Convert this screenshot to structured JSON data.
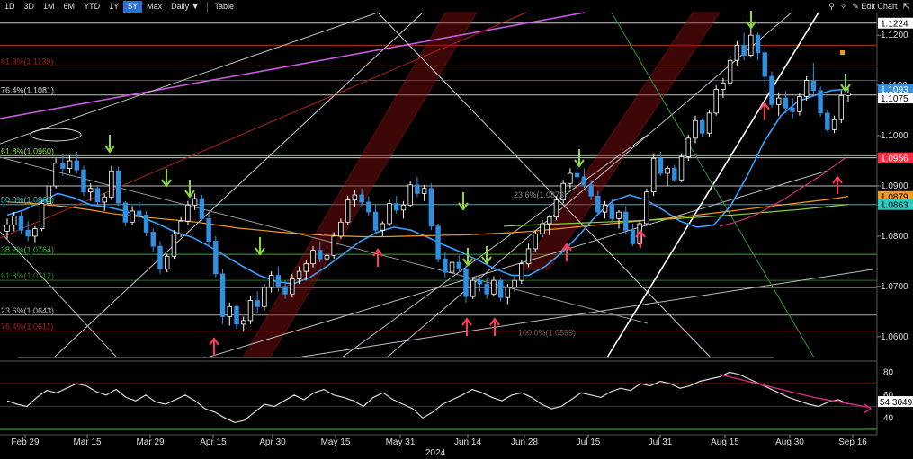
{
  "toolbar": {
    "ranges": [
      "1D",
      "3D",
      "1M",
      "6M",
      "YTD",
      "1Y",
      "5Y",
      "Max"
    ],
    "active_range": "5Y",
    "frequency": "Daily ▼",
    "table": "Table",
    "edit": "Edit Chart"
  },
  "chart_data": [
    {
      "type": "candlestick",
      "title": "",
      "ylim": [
        1.0555,
        1.1245
      ],
      "y_ticks": [
        "1.1200",
        "1.1100",
        "1.1000",
        "1.0900",
        "1.0800",
        "1.0700",
        "1.0600"
      ],
      "y_tick_values": [
        1.12,
        1.11,
        1.1,
        1.09,
        1.08,
        1.07,
        1.06
      ],
      "x_ticks": [
        "Feb 29",
        "Mar 15",
        "Mar 29",
        "Apr 15",
        "Apr 30",
        "May 15",
        "May 31",
        "Jun 14",
        "Jun 28",
        "Jul 15",
        "Jul 31",
        "Aug 15",
        "Aug 30",
        "Sep 16"
      ],
      "x_tick_dates": [
        "2024-02-29",
        "2024-03-15",
        "2024-03-29",
        "2024-04-15",
        "2024-04-30",
        "2024-05-15",
        "2024-05-31",
        "2024-06-14",
        "2024-06-28",
        "2024-07-15",
        "2024-07-31",
        "2024-08-15",
        "2024-08-30",
        "2024-09-16"
      ],
      "year_label": "2024",
      "price_tags": [
        {
          "text": "1.1224",
          "value": 1.1224,
          "bg": "#ffffff",
          "fg": "#000000"
        },
        {
          "text": "1.1093",
          "value": 1.1093,
          "bg": "#2f8fe0",
          "fg": "#ffffff"
        },
        {
          "text": "1.1075",
          "value": 1.1075,
          "bg": "#ffffff",
          "fg": "#000000"
        },
        {
          "text": "1.0956",
          "value": 1.0956,
          "bg": "#ff2b40",
          "fg": "#ffffff"
        },
        {
          "text": "1.0879",
          "value": 1.0879,
          "bg": "#f39a1e",
          "fg": "#000000"
        },
        {
          "text": "1.0863",
          "value": 1.0863,
          "bg": "#2fc9c0",
          "fg": "#000000"
        }
      ],
      "fib_labels": [
        {
          "text": "76.4%(1.1081)",
          "value": 1.1081,
          "color": "#d9d9d9"
        },
        {
          "text": "61.8%(1.0960)",
          "value": 1.096,
          "color": "#9fd84a"
        },
        {
          "text": "50.0%(1.0863)",
          "value": 1.0863,
          "color": "#2fc9c0"
        },
        {
          "text": "38.2%(1.0764)",
          "value": 1.0764,
          "color": "#39c23f"
        },
        {
          "text": "23.6%(1.0643)",
          "value": 1.0643,
          "color": "#bdbdbd"
        },
        {
          "text": "76.4%(1.0611)",
          "value": 1.0611,
          "color": "#b02020"
        },
        {
          "text": "61.8%(1.1139)",
          "value": 1.1139,
          "color": "#a02020"
        },
        {
          "text": "61.8%(1.0712)",
          "value": 1.0712,
          "color": "#2f7f2f"
        },
        {
          "text": "23.6%(1.0873)",
          "value": 1.0873,
          "color": "#8a8a8a"
        },
        {
          "text": "100.0%(1.0599)",
          "value": 1.0599,
          "color": "#6a6a6a"
        }
      ],
      "ohlc": [
        [
          1.081,
          1.0835,
          1.0795,
          1.0822
        ],
        [
          1.0822,
          1.0848,
          1.081,
          1.084
        ],
        [
          1.084,
          1.0848,
          1.0805,
          1.0812
        ],
        [
          1.0812,
          1.083,
          1.079,
          1.08
        ],
        [
          1.08,
          1.082,
          1.0788,
          1.0815
        ],
        [
          1.0815,
          1.0872,
          1.081,
          1.0865
        ],
        [
          1.0865,
          1.091,
          1.0858,
          1.09
        ],
        [
          1.09,
          1.0955,
          1.0895,
          1.0945
        ],
        [
          1.0945,
          1.0962,
          1.092,
          1.0935
        ],
        [
          1.0935,
          1.096,
          1.0925,
          1.095
        ],
        [
          1.095,
          1.0968,
          1.0925,
          1.0932
        ],
        [
          1.0932,
          1.094,
          1.088,
          1.0888
        ],
        [
          1.0888,
          1.0905,
          1.087,
          1.0895
        ],
        [
          1.0895,
          1.09,
          1.086,
          1.0868
        ],
        [
          1.0868,
          1.0885,
          1.085,
          1.0878
        ],
        [
          1.0878,
          1.094,
          1.0872,
          1.093
        ],
        [
          1.093,
          1.0938,
          1.086,
          1.0866
        ],
        [
          1.0866,
          1.087,
          1.082,
          1.0828
        ],
        [
          1.0828,
          1.086,
          1.0822,
          1.085
        ],
        [
          1.085,
          1.0868,
          1.0835,
          1.0842
        ],
        [
          1.0842,
          1.085,
          1.08,
          1.0808
        ],
        [
          1.0808,
          1.0815,
          1.077,
          1.078
        ],
        [
          1.078,
          1.079,
          1.0725,
          1.0735
        ],
        [
          1.0735,
          1.0765,
          1.0728,
          1.076
        ],
        [
          1.076,
          1.0812,
          1.0755,
          1.0805
        ],
        [
          1.0805,
          1.0838,
          1.0798,
          1.083
        ],
        [
          1.083,
          1.087,
          1.0822,
          1.0862
        ],
        [
          1.0862,
          1.0885,
          1.0852,
          1.0875
        ],
        [
          1.0875,
          1.0882,
          1.083,
          1.0835
        ],
        [
          1.0835,
          1.0845,
          1.078,
          1.079
        ],
        [
          1.079,
          1.08,
          1.0718,
          1.0725
        ],
        [
          1.0725,
          1.0735,
          1.0625,
          1.064
        ],
        [
          1.064,
          1.0668,
          1.0622,
          1.066
        ],
        [
          1.066,
          1.0665,
          1.0615,
          1.0625
        ],
        [
          1.0625,
          1.064,
          1.061,
          1.0632
        ],
        [
          1.0632,
          1.068,
          1.0625,
          1.0672
        ],
        [
          1.0672,
          1.069,
          1.0648,
          1.066
        ],
        [
          1.066,
          1.0705,
          1.0652,
          1.0698
        ],
        [
          1.0698,
          1.073,
          1.0688,
          1.0722
        ],
        [
          1.0722,
          1.074,
          1.069,
          1.07
        ],
        [
          1.07,
          1.0712,
          1.0675,
          1.0685
        ],
        [
          1.0685,
          1.0725,
          1.0678,
          1.0715
        ],
        [
          1.0715,
          1.074,
          1.0705,
          1.073
        ],
        [
          1.073,
          1.0752,
          1.0712,
          1.0745
        ],
        [
          1.0745,
          1.078,
          1.0738,
          1.0772
        ],
        [
          1.0772,
          1.079,
          1.0748,
          1.0755
        ],
        [
          1.0755,
          1.077,
          1.0738,
          1.0762
        ],
        [
          1.0762,
          1.0808,
          1.0755,
          1.08
        ],
        [
          1.08,
          1.0835,
          1.0795,
          1.0828
        ],
        [
          1.0828,
          1.088,
          1.0822,
          1.0872
        ],
        [
          1.0872,
          1.0892,
          1.0858,
          1.0882
        ],
        [
          1.0882,
          1.0895,
          1.086,
          1.0868
        ],
        [
          1.0868,
          1.088,
          1.084,
          1.0848
        ],
        [
          1.0848,
          1.0862,
          1.0805,
          1.0812
        ],
        [
          1.0812,
          1.083,
          1.08,
          1.0825
        ],
        [
          1.0825,
          1.0872,
          1.082,
          1.0865
        ],
        [
          1.0865,
          1.088,
          1.0845,
          1.0852
        ],
        [
          1.0852,
          1.087,
          1.0835,
          1.0862
        ],
        [
          1.0862,
          1.091,
          1.0858,
          1.0902
        ],
        [
          1.0902,
          1.0918,
          1.0878,
          1.0885
        ],
        [
          1.0885,
          1.0902,
          1.087,
          1.0895
        ],
        [
          1.0895,
          1.0905,
          1.0812,
          1.082
        ],
        [
          1.082,
          1.0825,
          1.0748,
          1.0755
        ],
        [
          1.0755,
          1.0768,
          1.0718,
          1.0728
        ],
        [
          1.0728,
          1.0755,
          1.0722,
          1.0748
        ],
        [
          1.0748,
          1.0762,
          1.0728,
          1.0735
        ],
        [
          1.0735,
          1.0742,
          1.0668,
          1.068
        ],
        [
          1.068,
          1.0718,
          1.0675,
          1.0712
        ],
        [
          1.0712,
          1.072,
          1.069,
          1.0705
        ],
        [
          1.0705,
          1.0718,
          1.0675,
          1.0685
        ],
        [
          1.0685,
          1.072,
          1.068,
          1.0712
        ],
        [
          1.0712,
          1.0718,
          1.067,
          1.0678
        ],
        [
          1.0678,
          1.0705,
          1.0665,
          1.0698
        ],
        [
          1.0698,
          1.072,
          1.069,
          1.0712
        ],
        [
          1.0712,
          1.0752,
          1.0705,
          1.0745
        ],
        [
          1.0745,
          1.0785,
          1.0738,
          1.0775
        ],
        [
          1.0775,
          1.0812,
          1.0768,
          1.0805
        ],
        [
          1.0805,
          1.0832,
          1.0798,
          1.0825
        ],
        [
          1.0825,
          1.0842,
          1.0802,
          1.0838
        ],
        [
          1.0838,
          1.088,
          1.0832,
          1.0872
        ],
        [
          1.0872,
          1.0912,
          1.0865,
          1.0905
        ],
        [
          1.0905,
          1.0935,
          1.0895,
          1.0925
        ],
        [
          1.0925,
          1.0952,
          1.091,
          1.0918
        ],
        [
          1.0918,
          1.0935,
          1.0895,
          1.0902
        ],
        [
          1.0902,
          1.0912,
          1.0872,
          1.088
        ],
        [
          1.088,
          1.089,
          1.0842,
          1.0848
        ],
        [
          1.0848,
          1.087,
          1.0835,
          1.0862
        ],
        [
          1.0862,
          1.0875,
          1.0825,
          1.0835
        ],
        [
          1.0835,
          1.0852,
          1.0815,
          1.0848
        ],
        [
          1.0848,
          1.086,
          1.0805,
          1.0812
        ],
        [
          1.0812,
          1.0825,
          1.078,
          1.0785
        ],
        [
          1.0785,
          1.083,
          1.078,
          1.0825
        ],
        [
          1.0825,
          1.0895,
          1.082,
          1.0888
        ],
        [
          1.0888,
          1.0965,
          1.088,
          1.0955
        ],
        [
          1.0955,
          1.0968,
          1.092,
          1.0925
        ],
        [
          1.0925,
          1.094,
          1.09,
          1.0935
        ],
        [
          1.0935,
          1.0942,
          1.0908,
          1.0912
        ],
        [
          1.0912,
          1.0965,
          1.0908,
          1.0958
        ],
        [
          1.0958,
          1.1002,
          1.095,
          1.0995
        ],
        [
          1.0995,
          1.104,
          1.0985,
          1.103
        ],
        [
          1.103,
          1.1035,
          1.0998,
          1.1005
        ],
        [
          1.1005,
          1.105,
          1.0998,
          1.1045
        ],
        [
          1.1045,
          1.11,
          1.104,
          1.1092
        ],
        [
          1.1092,
          1.1115,
          1.1075,
          1.1105
        ],
        [
          1.1105,
          1.116,
          1.11,
          1.115
        ],
        [
          1.115,
          1.1188,
          1.114,
          1.118
        ],
        [
          1.118,
          1.1205,
          1.115,
          1.116
        ],
        [
          1.116,
          1.1215,
          1.1155,
          1.12
        ],
        [
          1.12,
          1.1205,
          1.115,
          1.1165
        ],
        [
          1.1165,
          1.1178,
          1.1105,
          1.1118
        ],
        [
          1.1118,
          1.1128,
          1.1055,
          1.1062
        ],
        [
          1.1062,
          1.1085,
          1.104,
          1.1075
        ],
        [
          1.1075,
          1.109,
          1.1045,
          1.1055
        ],
        [
          1.1055,
          1.1075,
          1.1035,
          1.1048
        ],
        [
          1.1048,
          1.1085,
          1.104,
          1.1078
        ],
        [
          1.1078,
          1.1118,
          1.107,
          1.111
        ],
        [
          1.111,
          1.1145,
          1.1082,
          1.109
        ],
        [
          1.109,
          1.1098,
          1.1038,
          1.1045
        ],
        [
          1.1045,
          1.105,
          1.1008,
          1.1012
        ],
        [
          1.1012,
          1.104,
          1.1005,
          1.1032
        ],
        [
          1.1032,
          1.109,
          1.1025,
          1.108
        ],
        [
          1.108,
          1.1098,
          1.1068,
          1.1085
        ]
      ],
      "moving_averages": [
        {
          "name": "",
          "color": "#3aa0ff",
          "values": [
            1.0842,
            1.0852,
            1.0868,
            1.0885,
            1.0876,
            1.0862,
            1.0858,
            1.085,
            1.0838,
            1.0824,
            1.0808,
            1.0798,
            1.078,
            1.076,
            1.074,
            1.0722,
            1.071,
            1.0705,
            1.0718,
            1.074,
            1.0765,
            1.079,
            1.0808,
            1.0818,
            1.0812,
            1.0798,
            1.0782,
            1.0768,
            1.0752,
            1.0735,
            1.0722,
            1.0722,
            1.074,
            1.0768,
            1.0802,
            1.084,
            1.087,
            1.0882,
            1.0872,
            1.0852,
            1.083,
            1.0818,
            1.0822,
            1.086,
            1.092,
            1.0988,
            1.104,
            1.1068,
            1.108,
            1.109,
            1.1093
          ]
        },
        {
          "name": "",
          "color": "#f39a1e",
          "values": [
            1.0868,
            1.0866,
            1.0862,
            1.0858,
            1.0852,
            1.0845,
            1.084,
            1.0836,
            1.0832,
            1.0828,
            1.0822,
            1.0816,
            1.0812,
            1.0808,
            1.0805,
            1.0802,
            1.08,
            1.0799,
            1.0799,
            1.08,
            1.0801,
            1.0802,
            1.0803,
            1.0805,
            1.0807,
            1.081,
            1.0814,
            1.0818,
            1.0822,
            1.0826,
            1.083,
            1.0834,
            1.0838,
            1.0843,
            1.0848,
            1.0853,
            1.0858,
            1.0863,
            1.0868,
            1.0873,
            1.0879
          ]
        },
        {
          "name": "",
          "color": "#8fcf3f",
          "values": [
            1.082,
            1.0822,
            1.0824,
            1.0826,
            1.0828,
            1.083,
            1.0832,
            1.0835,
            1.0838,
            1.0841,
            1.0845,
            1.0849,
            1.0853,
            1.0858,
            1.0863
          ]
        },
        {
          "name": "",
          "color": "#d02e7a",
          "values": [
            1.082,
            1.0826,
            1.0834,
            1.0844,
            1.0858,
            1.0872,
            1.0888,
            1.0904,
            1.092,
            1.0938,
            1.0956
          ]
        }
      ]
    },
    {
      "type": "line",
      "title": "",
      "ylim": [
        30,
        85
      ],
      "y_ticks": [
        "80",
        "60",
        "40"
      ],
      "y_tick_values": [
        80,
        60,
        40
      ],
      "value_tag": {
        "text": "54.3049",
        "value": 54.3049
      },
      "bands": [
        70,
        30
      ],
      "series": [
        {
          "name": "",
          "color": "#d8d8d8",
          "values": [
            55,
            52,
            50,
            58,
            64,
            62,
            66,
            70,
            68,
            63,
            60,
            65,
            58,
            55,
            60,
            54,
            52,
            56,
            60,
            55,
            48,
            45,
            40,
            36,
            38,
            45,
            52,
            50,
            55,
            60,
            56,
            62,
            65,
            60,
            58,
            55,
            50,
            58,
            62,
            56,
            52,
            48,
            40,
            45,
            52,
            56,
            60,
            65,
            62,
            58,
            55,
            60,
            62,
            58,
            52,
            48,
            50,
            56,
            62,
            60,
            58,
            63,
            66,
            64,
            70,
            68,
            72,
            70,
            66,
            68,
            72,
            74,
            76,
            80,
            78,
            74,
            70,
            66,
            62,
            58,
            55,
            52,
            50,
            54,
            56,
            52
          ]
        },
        {
          "name": "",
          "color": "#d02e7a",
          "values": [
            78,
            74,
            70,
            66,
            62,
            58,
            55,
            52,
            49
          ]
        }
      ]
    }
  ]
}
